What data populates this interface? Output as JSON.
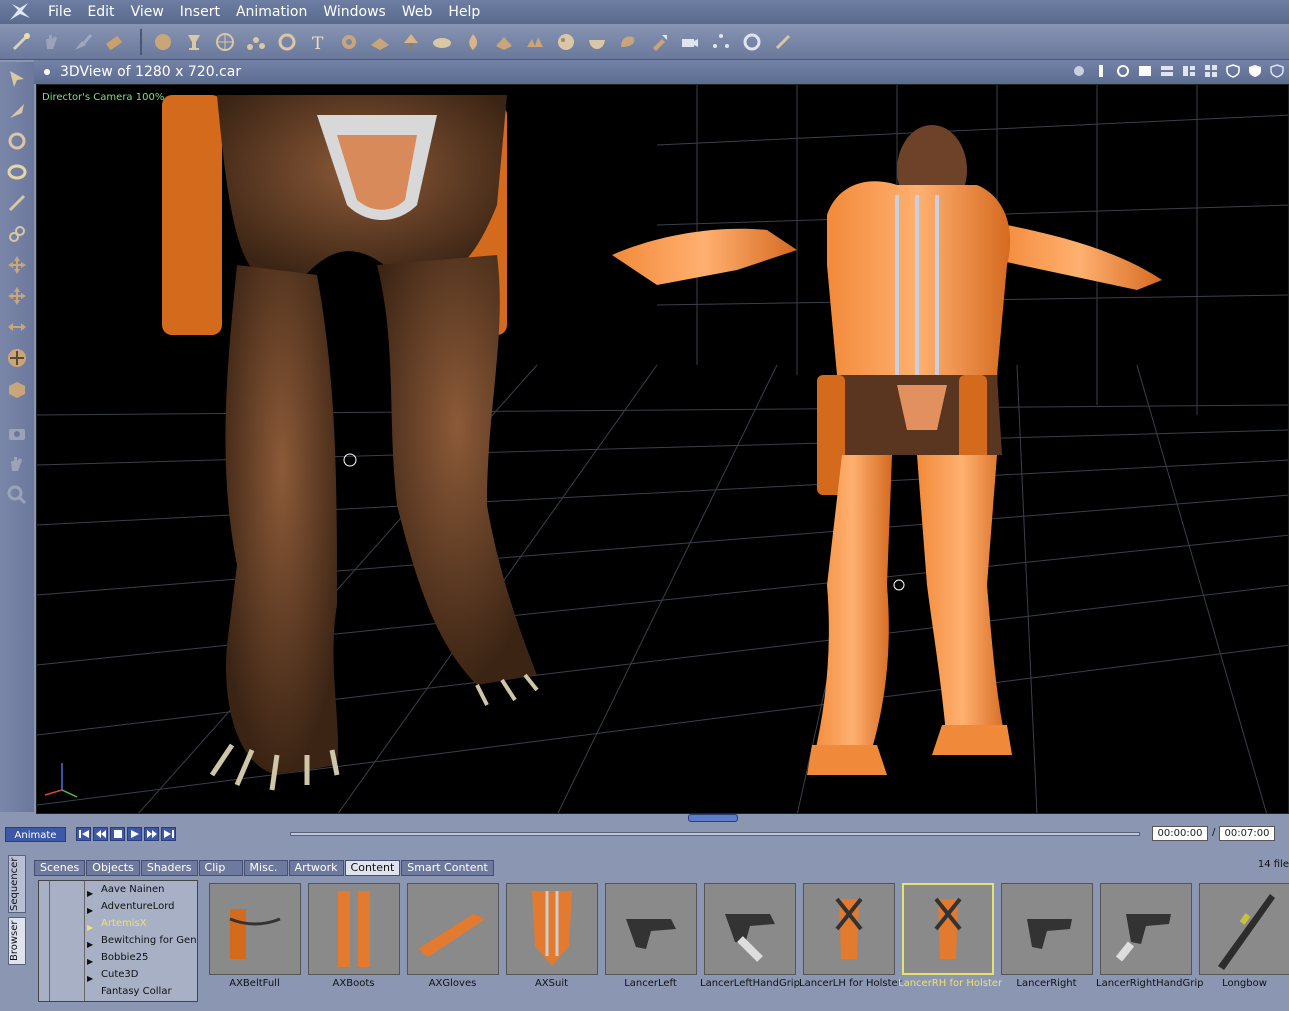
{
  "menubar": {
    "items": [
      "File",
      "Edit",
      "View",
      "Insert",
      "Animation",
      "Windows",
      "Web",
      "Help"
    ]
  },
  "view": {
    "title": "3DView of 1280 x 720.car",
    "camera_label": "Director's Camera 100%"
  },
  "animation": {
    "animate_label": "Animate",
    "current_time": "00:00:00",
    "separator": "/",
    "end_time": "00:07:00"
  },
  "browser": {
    "side_tabs": [
      "Sequencer",
      "Browser"
    ],
    "tabs": [
      "Scenes",
      "Objects",
      "Shaders",
      "Clip",
      "Misc.",
      "Artwork",
      "Content",
      "Smart Content"
    ],
    "active_tab": "Content",
    "file_count": "14 file",
    "tree_items": [
      "Aave Nainen",
      "AdventureLord",
      "ArtemisX",
      "Bewitching for Gene",
      "Bobbie25",
      "Cute3D",
      "Fantasy Collar"
    ],
    "tree_selected": "ArtemisX",
    "thumbnails": [
      "AXBeltFull",
      "AXBoots",
      "AXGloves",
      "AXSuit",
      "LancerLeft",
      "LancerLeftHandGrip",
      "LancerLH for Holster",
      "LancerRH for Holster",
      "LancerRight",
      "LancerRightHandGrip",
      "Longbow"
    ],
    "thumbnail_selected": "LancerRH for Holster"
  },
  "colors": {
    "accent": "#3d58a6",
    "selected_text": "#f0e070",
    "panel": "#8a96b2"
  }
}
